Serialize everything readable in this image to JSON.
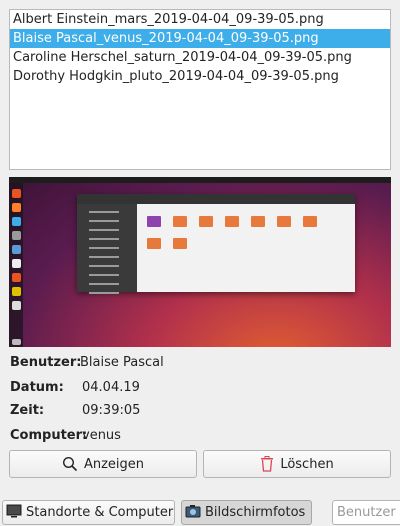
{
  "files": [
    {
      "name": "Albert Einstein_mars_2019-04-04_09-39-05.png",
      "selected": false
    },
    {
      "name": "Blaise Pascal_venus_2019-04-04_09-39-05.png",
      "selected": true
    },
    {
      "name": "Caroline Herschel_saturn_2019-04-04_09-39-05.png",
      "selected": false
    },
    {
      "name": "Dorothy Hodgkin_pluto_2019-04-04_09-39-05.png",
      "selected": false
    }
  ],
  "details": {
    "user_label": "Benutzer:",
    "user_value": "Blaise Pascal",
    "date_label": "Datum:",
    "date_value": "04.04.19",
    "time_label": "Zeit:",
    "time_value": "09:39:05",
    "computer_label": "Computer:",
    "computer_value": "venus"
  },
  "actions": {
    "view_label": "Anzeigen",
    "view_icon": "search-icon",
    "delete_label": "Löschen",
    "delete_icon": "trash-icon",
    "delete_color": "#da4453"
  },
  "bottom_bar": {
    "locations_label": "Standorte & Computer",
    "screenshots_label": "Bildschirmfotos",
    "search_placeholder": "Benutzer u"
  },
  "colors": {
    "selection": "#3daee9"
  }
}
